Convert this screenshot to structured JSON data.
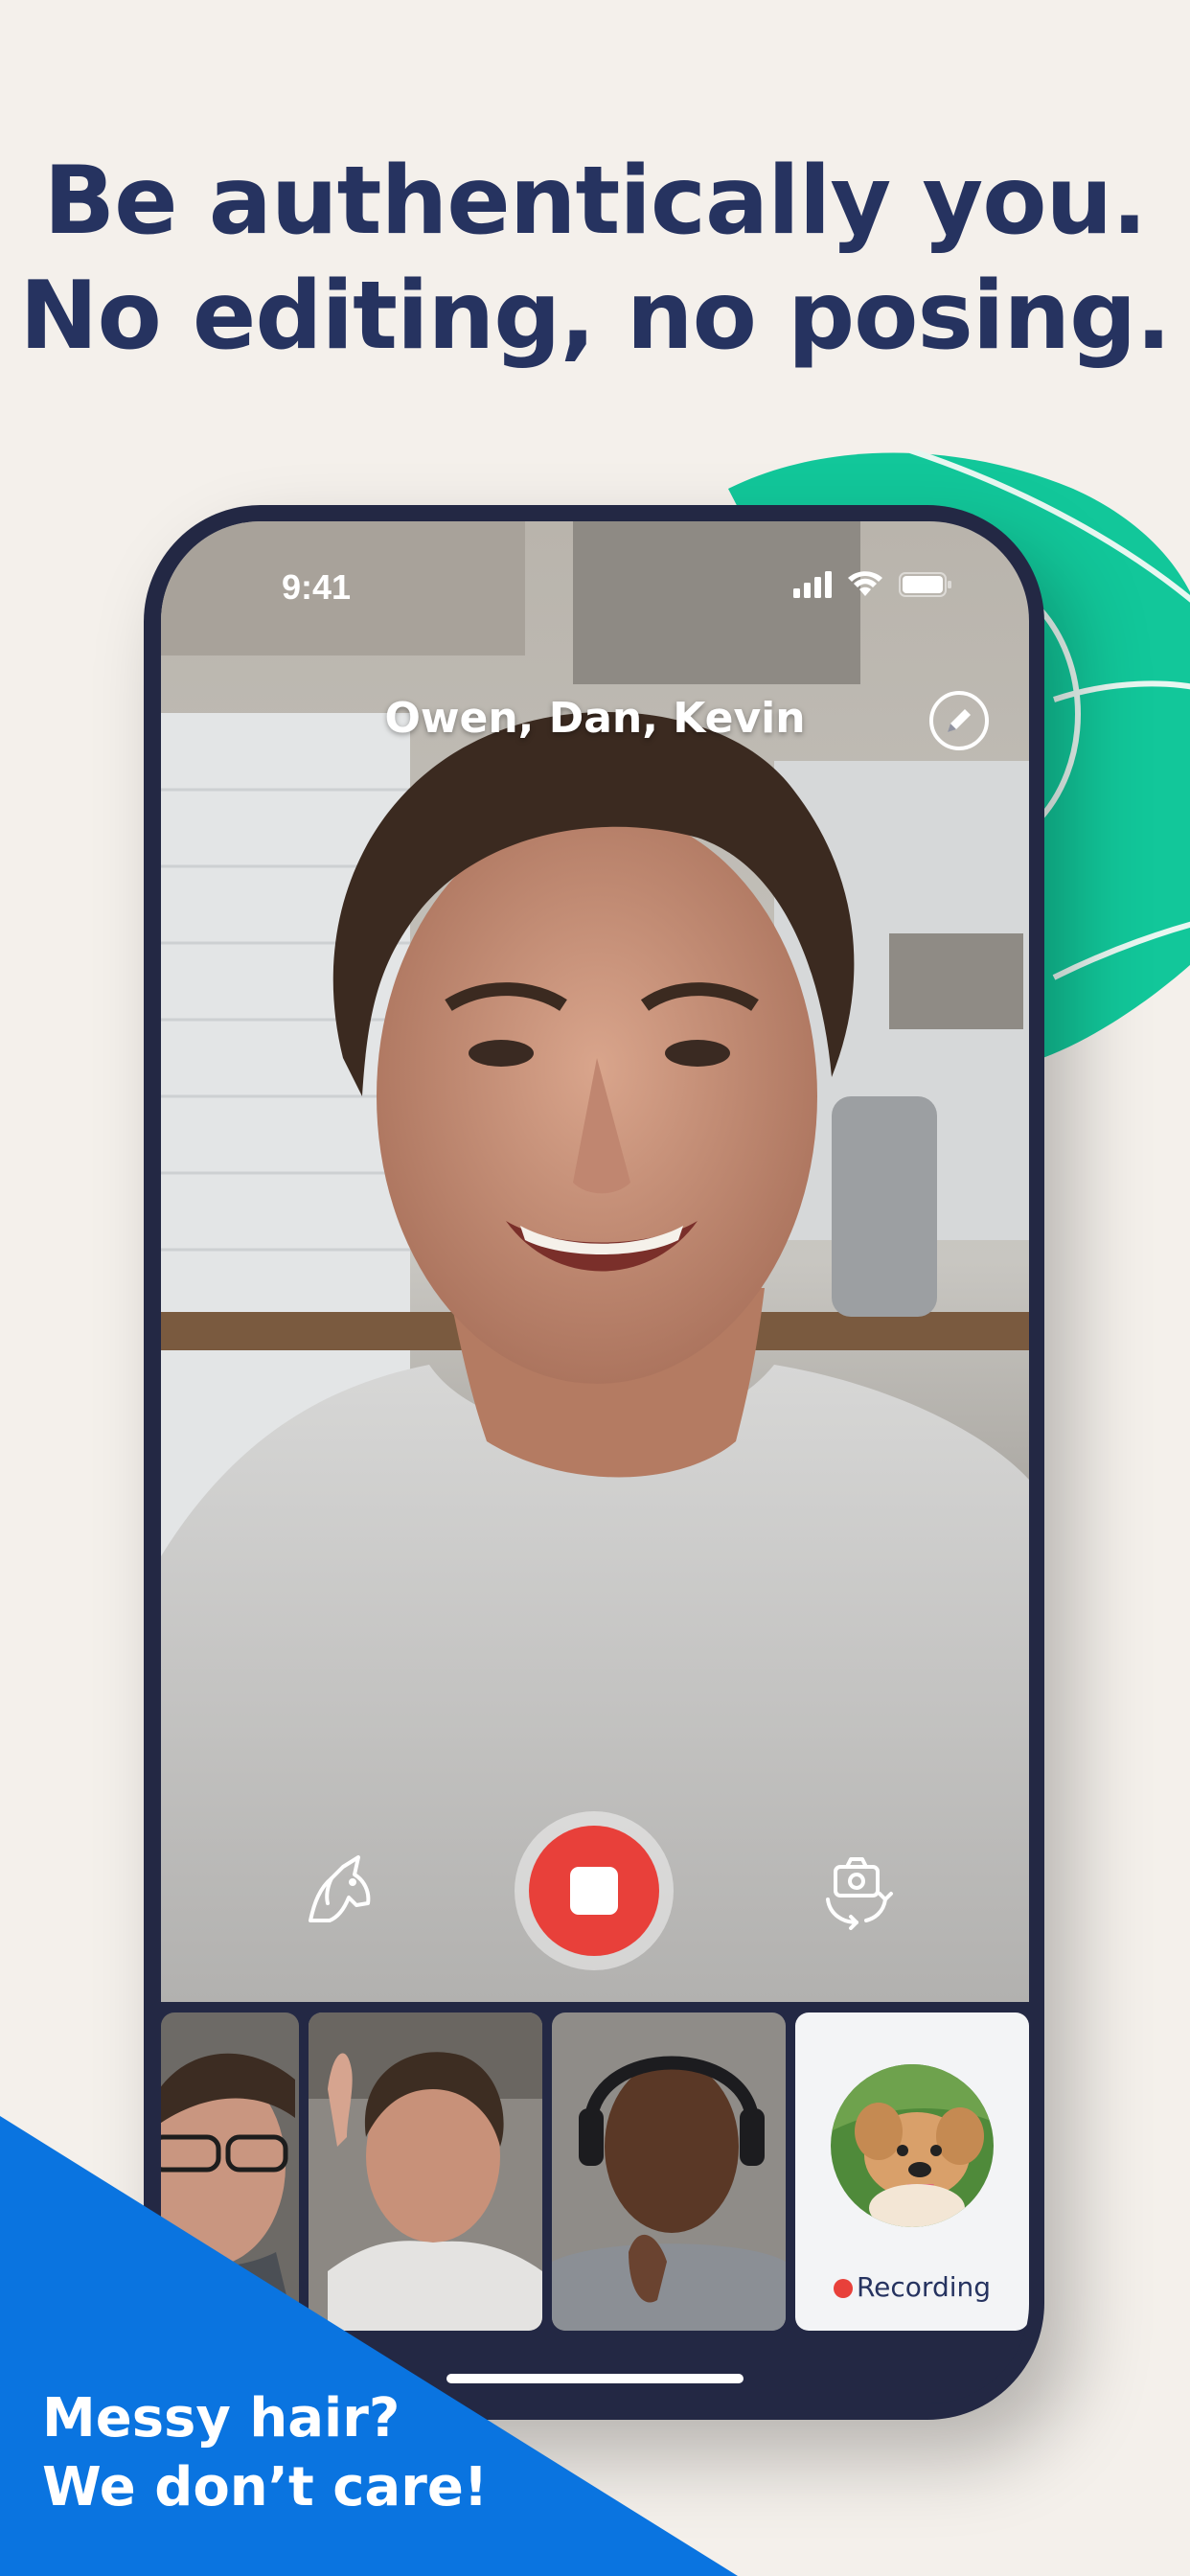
{
  "headline": {
    "line1": "Be authentically you.",
    "line2": "No editing, no posing."
  },
  "status_bar": {
    "time": "9:41",
    "icons": [
      "signal-icon",
      "wifi-icon",
      "battery-icon"
    ]
  },
  "call": {
    "participants_title": "Owen, Dan, Kevin",
    "edit_icon": "pencil-icon"
  },
  "controls": {
    "filter_icon": "unicorn-icon",
    "record_icon": "stop-icon",
    "flip_camera_icon": "camera-flip-icon"
  },
  "thumbnails": {
    "recording_label": "Recording"
  },
  "tagline": {
    "line1": "Messy hair?",
    "line2": "We don’t care!"
  },
  "colors": {
    "background": "#f4f0eb",
    "headline": "#263360",
    "green": "#12c79a",
    "blue": "#0a74e0",
    "record_red": "#e8403a",
    "phone_frame": "#232844"
  }
}
